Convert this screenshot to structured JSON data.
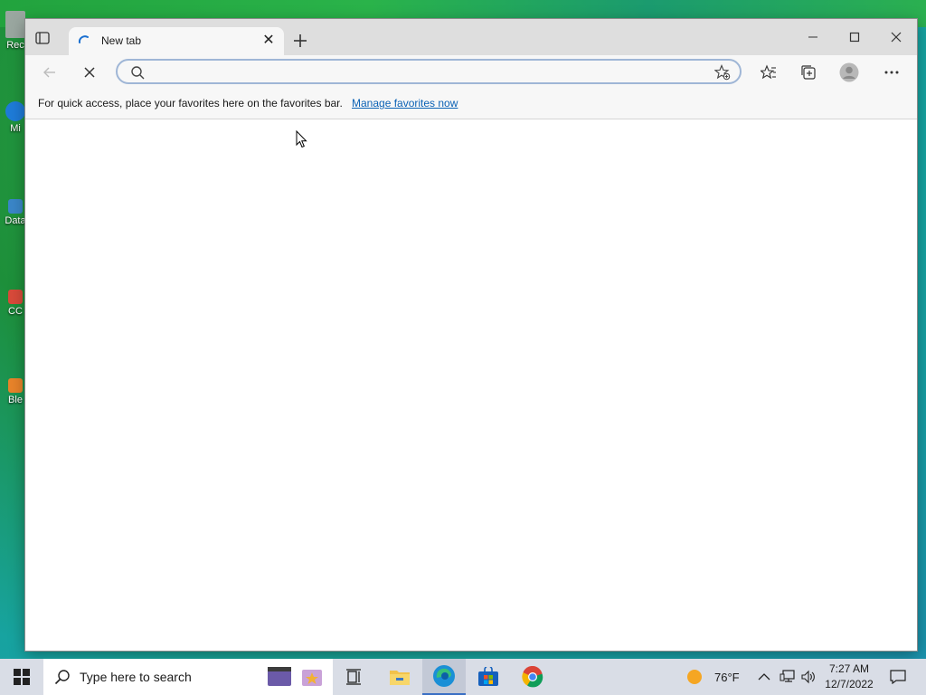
{
  "desktop": {
    "icons": [
      {
        "label": "Rec",
        "color": "#9aa7a0"
      },
      {
        "label": "Mi",
        "color": "#1e7bd7"
      },
      {
        "label": "Data",
        "color": "#3a86c8"
      },
      {
        "label": "CC",
        "color": "#d84a3a"
      },
      {
        "label": "Ble",
        "color": "#e8832a"
      }
    ]
  },
  "browser": {
    "tab": {
      "title": "New tab",
      "loading": true
    },
    "address_bar": {
      "value": "",
      "placeholder": ""
    },
    "favorites_bar": {
      "message": "For quick access, place your favorites here on the favorites bar.",
      "link": "Manage favorites now"
    },
    "accent": "#0b62b5"
  },
  "taskbar": {
    "search_placeholder": "Type here to search",
    "pinned": [
      "task-view",
      "file-explorer",
      "edge",
      "microsoft-store",
      "chrome"
    ],
    "active": "edge",
    "weather": "76°F",
    "time": "7:27 AM",
    "date": "12/7/2022"
  }
}
